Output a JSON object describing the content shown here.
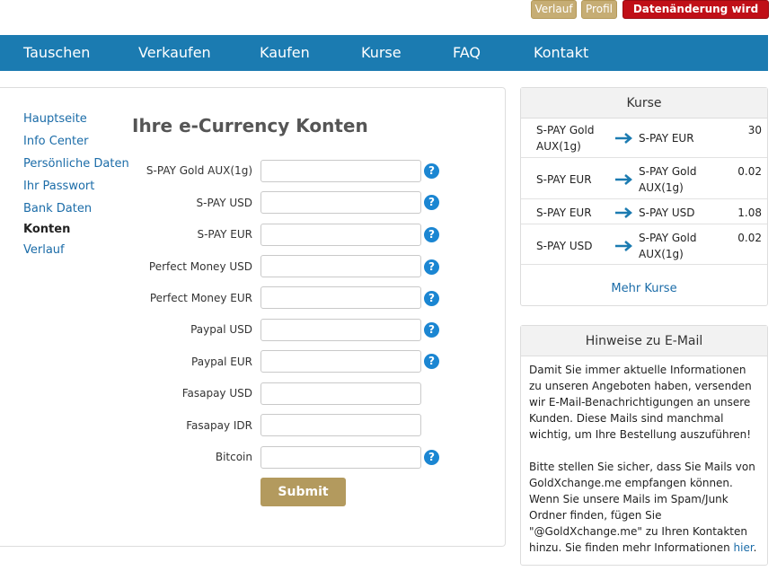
{
  "top_buttons": {
    "history": "Verlauf",
    "profile": "Profil",
    "status": "Datenänderung wird geprüft"
  },
  "nav": [
    "Tauschen",
    "Verkaufen",
    "Kaufen",
    "Kurse",
    "FAQ",
    "Kontakt"
  ],
  "sidebar": [
    "Hauptseite",
    "Info Center",
    "Persönliche Daten",
    "Ihr Passwort",
    "Bank Daten",
    "Konten",
    "Verlauf"
  ],
  "sidebar_active": "Konten",
  "page_title": "Ihre e-Currency Konten",
  "fields": [
    {
      "label": "S-PAY Gold AUX(1g)",
      "value": "",
      "help": true
    },
    {
      "label": "S-PAY USD",
      "value": "",
      "help": true
    },
    {
      "label": "S-PAY EUR",
      "value": "",
      "help": true
    },
    {
      "label": "Perfect Money USD",
      "value": "",
      "help": true
    },
    {
      "label": "Perfect Money EUR",
      "value": "",
      "help": true
    },
    {
      "label": "Paypal USD",
      "value": "",
      "help": true
    },
    {
      "label": "Paypal EUR",
      "value": "",
      "help": true
    },
    {
      "label": "Fasapay USD",
      "value": "",
      "help": false
    },
    {
      "label": "Fasapay IDR",
      "value": "",
      "help": false
    },
    {
      "label": "Bitcoin",
      "value": "",
      "help": true
    }
  ],
  "help_glyph": "?",
  "submit_label": "Submit",
  "rates": {
    "title": "Kurse",
    "rows": [
      {
        "from": "S-PAY Gold AUX(1g)",
        "to": "S-PAY EUR",
        "value": "30"
      },
      {
        "from": "S-PAY EUR",
        "to": "S-PAY Gold AUX(1g)",
        "value": "0.02"
      },
      {
        "from": "S-PAY EUR",
        "to": "S-PAY USD",
        "value": "1.08"
      },
      {
        "from": "S-PAY USD",
        "to": "S-PAY Gold AUX(1g)",
        "value": "0.02"
      }
    ],
    "more": "Mehr Kurse"
  },
  "email_notice": {
    "title": "Hinweise zu E-Mail",
    "p1": "Damit Sie immer aktuelle Informationen zu unseren Angeboten haben, versenden wir E-Mail-Benachrichtigungen an unsere Kunden. Diese Mails sind manchmal wichtig, um Ihre Bestellung auszuführen!",
    "p2": "Bitte stellen Sie sicher, dass Sie Mails von GoldXchange.me empfangen können. Wenn Sie unsere Mails im Spam/Junk Ordner finden, fügen Sie \"@GoldXchange.me\" zu Ihren Kontakten hinzu. Sie finden mehr Informationen",
    "link": "hier",
    "after_link": "."
  },
  "colors": {
    "nav": "#1b7bb1",
    "gold": "#c6ad74",
    "alert": "#c00f17",
    "link": "#1b6ca8",
    "help": "#1b86d2"
  }
}
